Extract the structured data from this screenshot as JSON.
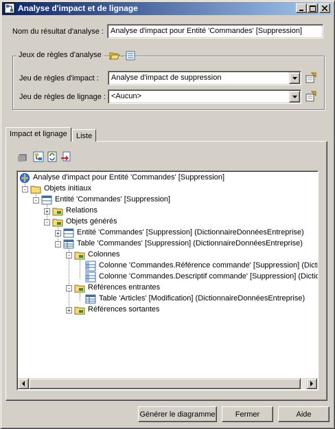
{
  "window": {
    "title": "Analyse d'impact et de lignage",
    "icon": "impact-analysis-icon",
    "buttons": [
      "minimize-icon",
      "maximize-icon",
      "close-icon"
    ]
  },
  "form": {
    "result_name_label": "Nom du résultat d'analyse :",
    "result_name_value": "Analyse d'impact pour Entité 'Commandes' [Suppression]"
  },
  "rulesets": {
    "group_title": "Jeux de règles d'analyse",
    "impact_label": "Jeu de règles d'impact :",
    "impact_value": "Analyse d'impact de suppression",
    "lineage_label": "Jeu de règles de lignage :",
    "lineage_value": "<Aucun>"
  },
  "tabs": [
    {
      "label": "Impact et lignage",
      "active": true
    },
    {
      "label": "Liste",
      "active": false
    }
  ],
  "toolbar": [
    "properties-icon",
    "generate-diagram-icon",
    "refresh-icon",
    "delete-icon"
  ],
  "tree": [
    {
      "label": "Analyse d'impact pour Entité 'Commandes' [Suppression]",
      "icon": "analysis-root-icon",
      "expander": ""
    },
    {
      "label": "Objets initiaux",
      "icon": "folder-icon",
      "expander": "-"
    },
    {
      "label": "Entité 'Commandes' [Suppression]",
      "icon": "entity-icon",
      "expander": "-"
    },
    {
      "label": "Relations",
      "icon": "folder-icon",
      "expander": "+"
    },
    {
      "label": "Objets générés",
      "icon": "folder-icon",
      "expander": "-"
    },
    {
      "label": "Entité 'Commandes' [Suppression] (DictionnaireDonnéesEntreprise)",
      "icon": "entity-icon",
      "expander": "+"
    },
    {
      "label": "Table 'Commandes' [Suppression] (DictionnaireDonnéesEntreprise)",
      "icon": "table-icon",
      "expander": "-"
    },
    {
      "label": "Colonnes",
      "icon": "folder-icon",
      "expander": "-"
    },
    {
      "label": "Colonne 'Commandes.Référence commande' [Suppression] (Dictio",
      "icon": "column-icon",
      "expander": ""
    },
    {
      "label": "Colonne 'Commandes.Descriptif commande' [Suppression] (Dictio",
      "icon": "column-icon",
      "expander": ""
    },
    {
      "label": "Références entrantes",
      "icon": "folder-icon",
      "expander": "-"
    },
    {
      "label": "Table 'Articles' [Modification] (DictionnaireDonnéesEntreprise)",
      "icon": "table-icon",
      "expander": ""
    },
    {
      "label": "Références sortantes",
      "icon": "folder-icon",
      "expander": "+"
    }
  ],
  "footer": {
    "generate_label": "Générer le diagramme",
    "close_label": "Fermer",
    "help_label": "Aide"
  }
}
